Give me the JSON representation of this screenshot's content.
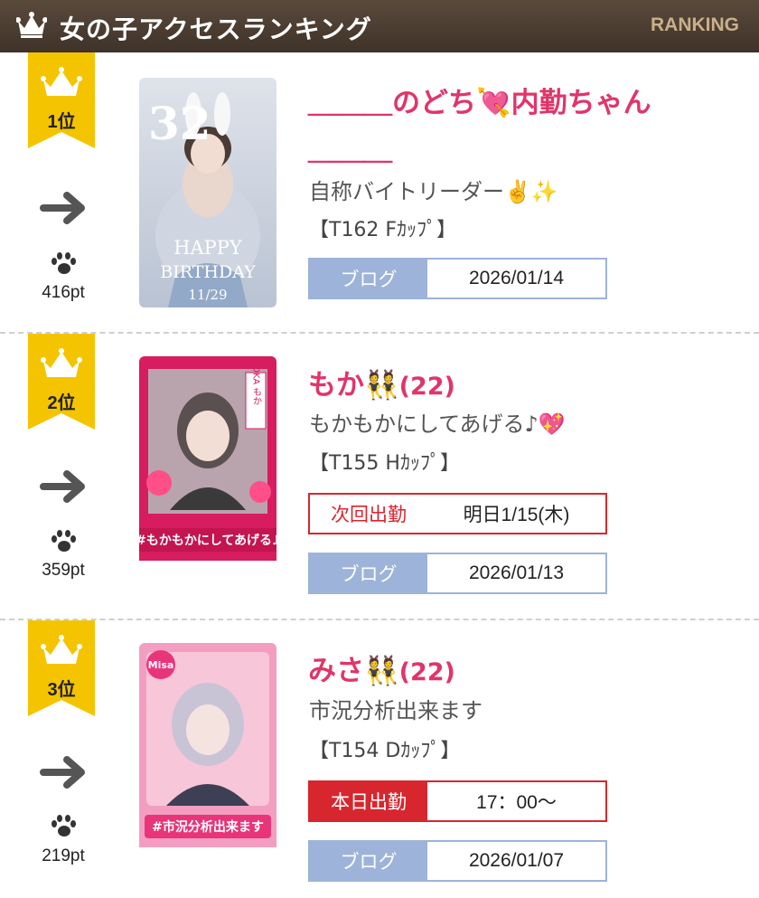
{
  "header": {
    "title": "女の子アクセスランキング",
    "subtitle": "RANKING",
    "icon": "crown-icon"
  },
  "colors": {
    "header_bg": "#4a3b2f",
    "badge_gold": "#f5c400",
    "name_pink": "#e0356a",
    "blog_blue": "#9db3d9",
    "schedule_red": "#d8262f"
  },
  "ranking": [
    {
      "rank_label": "1位",
      "trend_icon": "arrow-right-icon",
      "points": "416pt",
      "name": "＿＿＿のどち💘内勤ちゃん",
      "name_continuation": "＿＿＿",
      "comment": "自称バイトリーダー✌️✨",
      "spec": "【T162 Fｶｯﾌﾟ】",
      "photo_text": {
        "line1": "32",
        "line2": "HAPPY",
        "line3": "BIRTHDAY",
        "line4": "11/29"
      },
      "schedule": null,
      "blog": {
        "label": "ブログ",
        "date": "2026/01/14"
      }
    },
    {
      "rank_label": "2位",
      "trend_icon": "arrow-right-icon",
      "points": "359pt",
      "name": "もか👯",
      "age": "(22)",
      "comment": "もかもかにしてあげる♪💖",
      "spec": "【T155 Hｶｯﾌﾟ】",
      "photo_text": {
        "line1": "MOKA もか",
        "line2": "#もかもかにしてあげる♪"
      },
      "schedule": {
        "label": "次回出勤",
        "value": "明日1/15(木)",
        "style": "outline"
      },
      "blog": {
        "label": "ブログ",
        "date": "2026/01/13"
      }
    },
    {
      "rank_label": "3位",
      "trend_icon": "arrow-right-icon",
      "points": "219pt",
      "name": "みさ👯",
      "age": "(22)",
      "comment": "市況分析出来ます",
      "spec": "【T154 Dｶｯﾌﾟ】",
      "photo_text": {
        "line1": "Misa",
        "line2": "#市況分析出来ます"
      },
      "schedule": {
        "label": "本日出勤",
        "value": "17：00〜",
        "style": "solid"
      },
      "blog": {
        "label": "ブログ",
        "date": "2026/01/07"
      }
    }
  ]
}
